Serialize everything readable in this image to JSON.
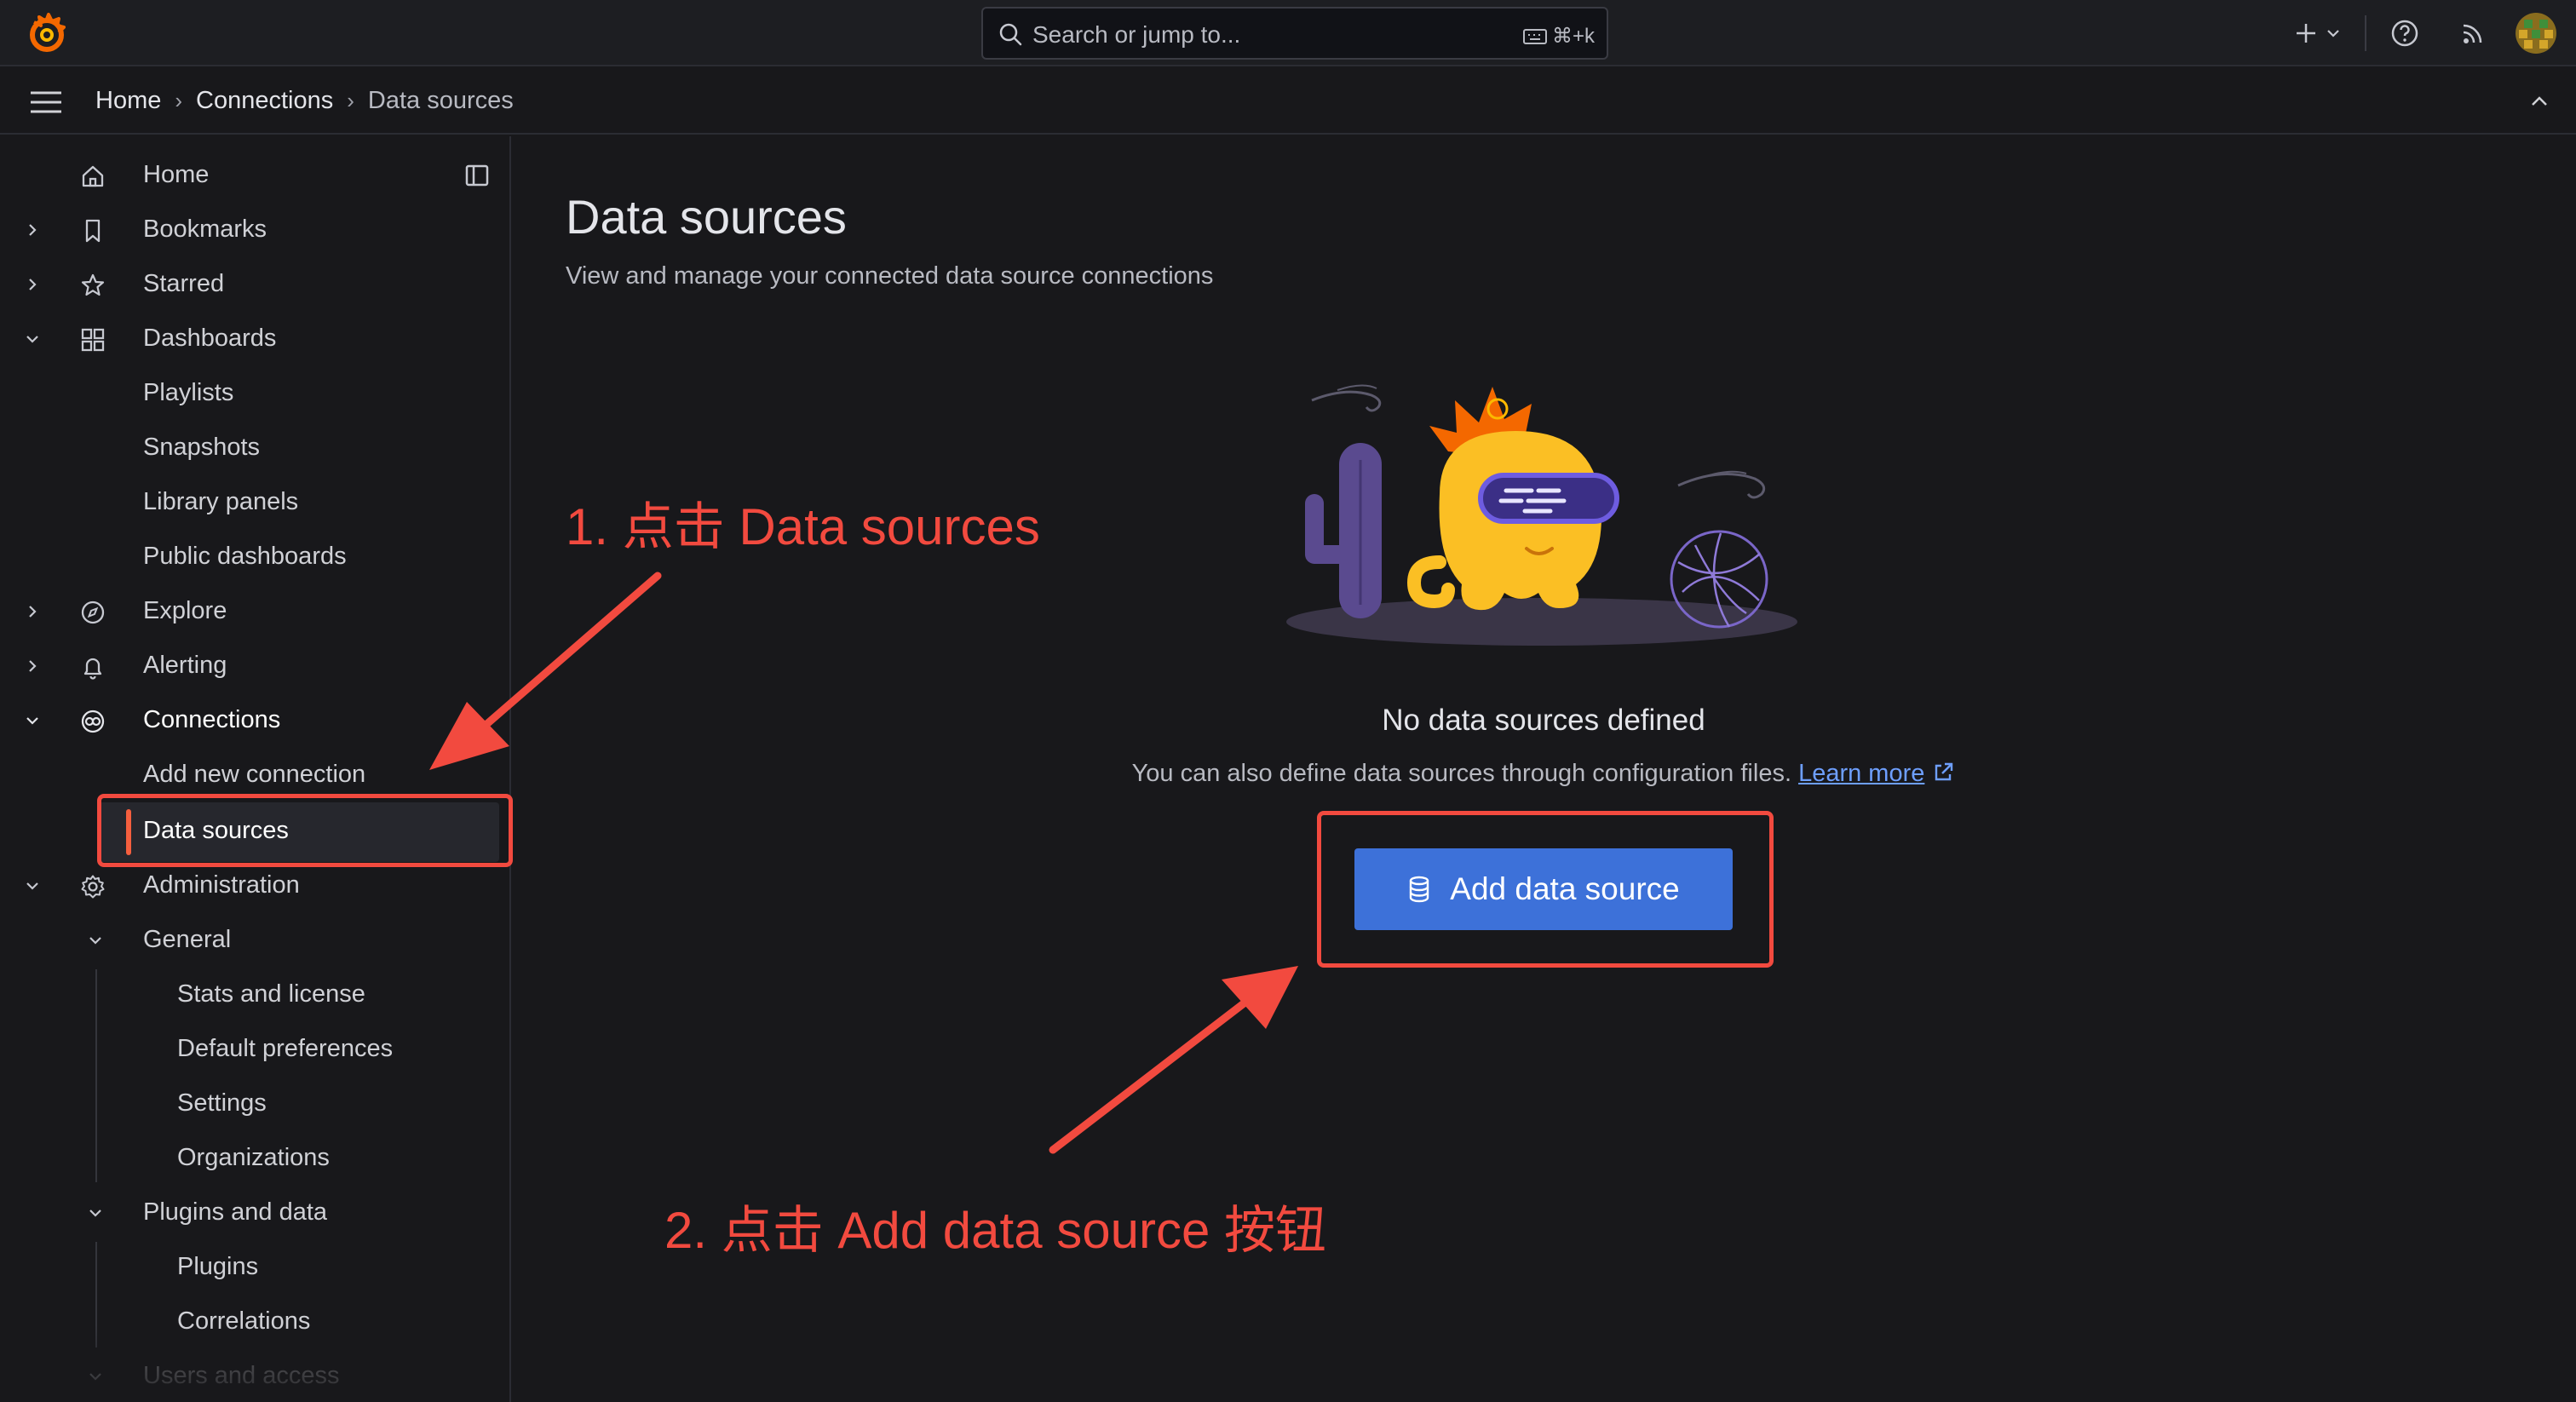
{
  "colors": {
    "accent": "#3d71d9",
    "active_indicator": "#f55f3e",
    "annotation": "#f24a3f",
    "link": "#6e9fff"
  },
  "topbar": {
    "logo_icon": "grafana-logo-icon",
    "search_placeholder": "Search or jump to...",
    "search_shortcut": "⌘+k",
    "new_icon": "plus-icon",
    "help_icon": "help-icon",
    "news_icon": "rss-icon",
    "avatar_icon": "user-avatar"
  },
  "breadcrumb": {
    "items": [
      "Home",
      "Connections",
      "Data sources"
    ]
  },
  "sidebar": {
    "items": [
      {
        "label": "Home",
        "icon": "home-icon"
      },
      {
        "label": "Bookmarks",
        "icon": "bookmark-icon"
      },
      {
        "label": "Starred",
        "icon": "star-icon"
      },
      {
        "label": "Dashboards",
        "icon": "apps-icon"
      },
      {
        "label": "Playlists"
      },
      {
        "label": "Snapshots"
      },
      {
        "label": "Library panels"
      },
      {
        "label": "Public dashboards"
      },
      {
        "label": "Explore",
        "icon": "compass-icon"
      },
      {
        "label": "Alerting",
        "icon": "bell-icon"
      },
      {
        "label": "Connections",
        "icon": "connections-icon"
      },
      {
        "label": "Add new connection"
      },
      {
        "label": "Data sources"
      },
      {
        "label": "Administration",
        "icon": "cog-icon"
      },
      {
        "label": "General"
      },
      {
        "label": "Stats and license"
      },
      {
        "label": "Default preferences"
      },
      {
        "label": "Settings"
      },
      {
        "label": "Organizations"
      },
      {
        "label": "Plugins and data"
      },
      {
        "label": "Plugins"
      },
      {
        "label": "Correlations"
      },
      {
        "label": "Users and access"
      }
    ]
  },
  "main": {
    "title": "Data sources",
    "subtitle": "View and manage your connected data source connections",
    "empty_title": "No data sources defined",
    "empty_text": "You can also define data sources through configuration files.",
    "learn_more": "Learn more",
    "add_button": "Add data source"
  },
  "annotations": {
    "step1": "1. 点击 Data sources",
    "step2": "2. 点击 Add data source 按钮"
  }
}
